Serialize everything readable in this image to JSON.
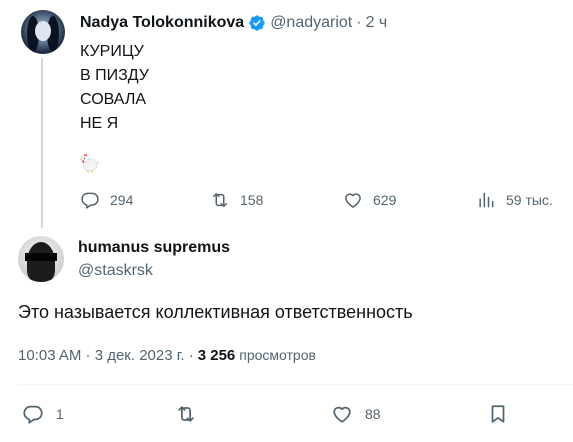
{
  "parent_tweet": {
    "author": {
      "display_name": "Nadya Tolokonnikova",
      "handle": "@nadyariot",
      "verified": true
    },
    "separator": "·",
    "time_ago": "2 ч",
    "text_lines": [
      "КУРИЦУ",
      "В ПИЗДУ",
      "СОВАЛА",
      "НЕ Я"
    ],
    "emoji": "chicken",
    "stats": {
      "replies": "294",
      "reposts": "158",
      "likes": "629",
      "views": "59 тыс."
    }
  },
  "reply_tweet": {
    "author": {
      "display_name": "humanus supremus",
      "handle": "@staskrsk"
    },
    "text": "Это называется коллективная ответственность",
    "timestamp": "10:03 AM · 3 дек. 2023 г. ·",
    "views_count": "3 256",
    "views_label": "просмотров",
    "stats": {
      "replies": "1",
      "reposts": "",
      "likes": "88"
    }
  },
  "colors": {
    "text_primary": "#0f1419",
    "text_secondary": "#536471",
    "verified_blue": "#1d9bf0",
    "thread_line": "#cfd9de"
  }
}
